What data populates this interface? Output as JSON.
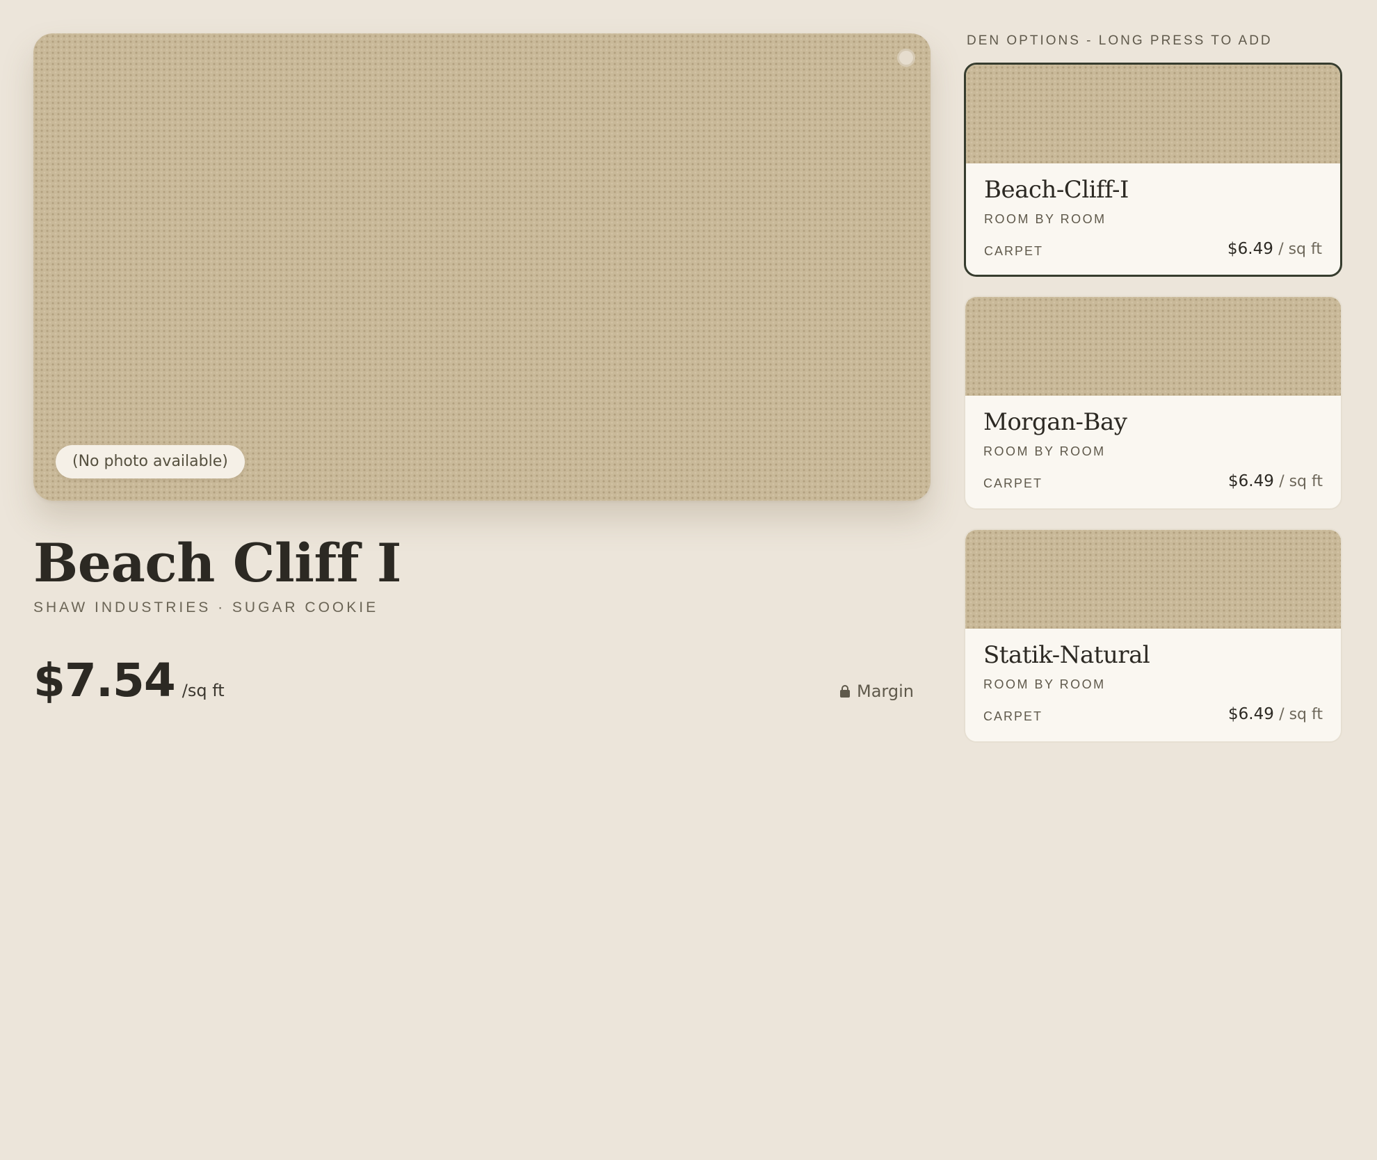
{
  "product": {
    "photo_badge": "(No photo available)",
    "title": "Beach Cliff I",
    "subtitle": "SHAW INDUSTRIES · SUGAR COOKIE",
    "price": "$7.54",
    "price_unit": "/sq ft",
    "margin_label": "Margin"
  },
  "options": {
    "header": "DEN OPTIONS - LONG PRESS TO ADD",
    "items": [
      {
        "name": "Beach-Cliff-I",
        "collection": "ROOM BY ROOM",
        "category": "CARPET",
        "price": "$6.49",
        "unit": "/ sq ft",
        "selected": true
      },
      {
        "name": "Morgan-Bay",
        "collection": "ROOM BY ROOM",
        "category": "CARPET",
        "price": "$6.49",
        "unit": "/ sq ft",
        "selected": false
      },
      {
        "name": "Statik-Natural",
        "collection": "ROOM BY ROOM",
        "category": "CARPET",
        "price": "$6.49",
        "unit": "/ sq ft",
        "selected": false
      }
    ]
  },
  "colors": {
    "background": "#ece5da",
    "swatch": "#c9b999",
    "card": "#faf7f1",
    "selected_border": "#363c2e",
    "text_primary": "#2c2923",
    "text_muted": "#5f594b"
  },
  "icons": {
    "margin": "lock-icon"
  }
}
